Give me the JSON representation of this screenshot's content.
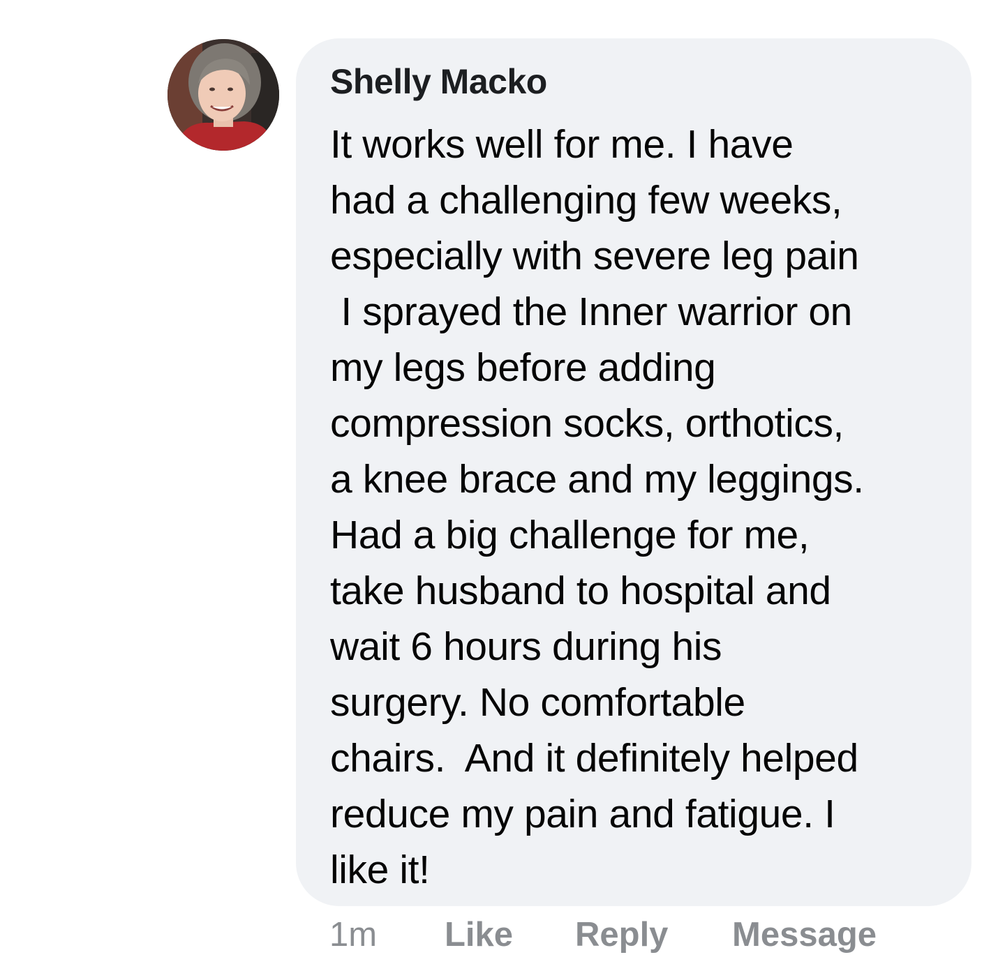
{
  "comment": {
    "author": "Shelly Macko",
    "text": "It works well for me. I have\nhad a challenging few weeks,\nespecially with severe leg pain\n I sprayed the Inner warrior on\nmy legs before adding\ncompression socks, orthotics,\na knee brace and my leggings.\nHad a big challenge for me,\ntake husband to hospital and\nwait 6 hours during his\nsurgery. No comfortable\nchairs.  And it definitely helped\nreduce my pain and fatigue. I\nlike it!"
  },
  "actions": {
    "time": "1m",
    "like": "Like",
    "reply": "Reply",
    "message": "Message"
  },
  "colors": {
    "bubble_bg": "#f0f2f5",
    "action_gray": "#8a8d91",
    "author_text": "#1c1e21",
    "body_text": "#050505"
  }
}
